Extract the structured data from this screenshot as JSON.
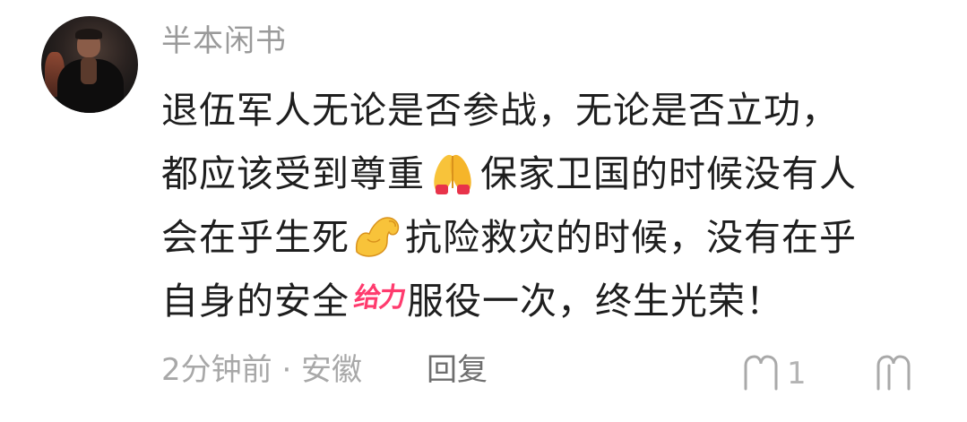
{
  "comment": {
    "username": "半本闲书",
    "text_line1": "退伍军人无论是否参战，无论是否立功，",
    "text_line2a": "都应该受到尊重",
    "emoji_1": "pray-hands-emoji",
    "text_line2b": "保家卫国的时候没有人",
    "text_line3a": "会在乎生死",
    "emoji_2": "flexed-biceps-emoji",
    "text_line3b": "抗险救灾的时候，没有在乎",
    "text_line4a": "自身的安全",
    "sticker_text": "给力",
    "text_line4b": "服役一次，终生光荣！",
    "meta": "2分钟前 · 安徽",
    "reply_label": "回复",
    "comment_count": "1",
    "comment_icon": "comment-bubble-icon",
    "like_icon": "like-icon"
  }
}
